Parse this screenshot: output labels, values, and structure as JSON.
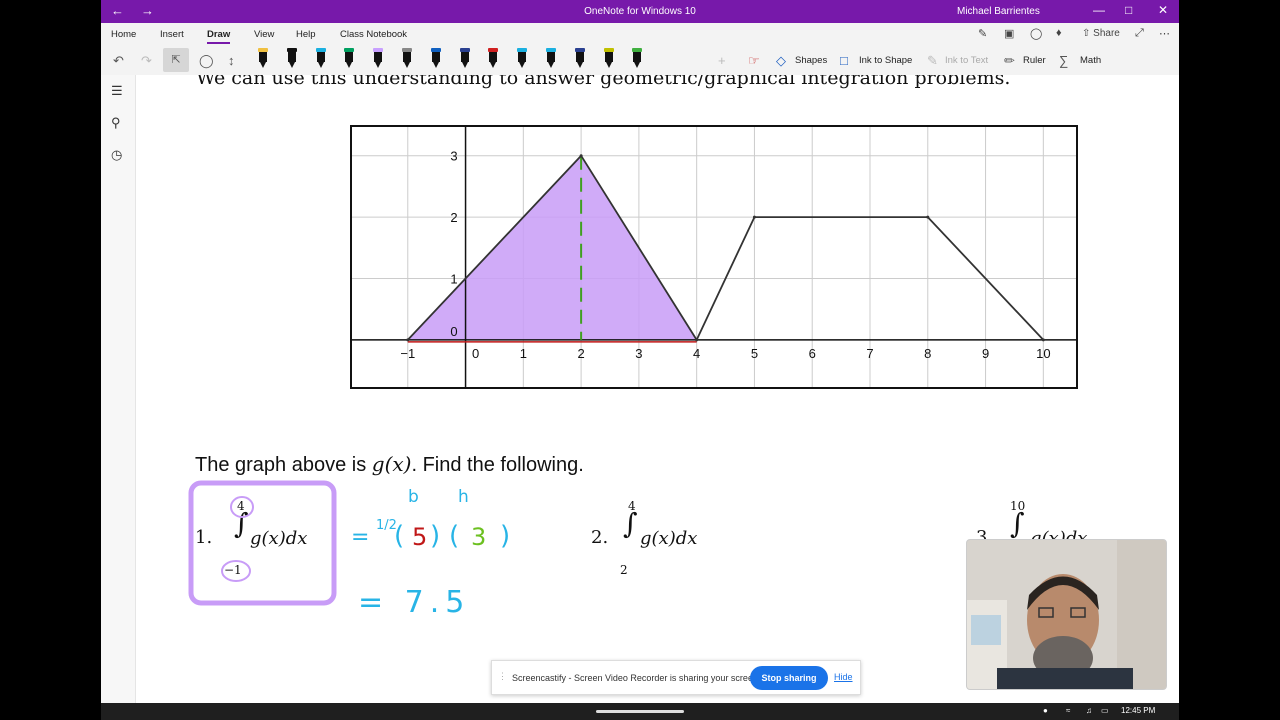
{
  "window": {
    "title": "OneNote for Windows 10",
    "user": "Michael Barrientes"
  },
  "menu": {
    "tabs": [
      "Home",
      "Insert",
      "Draw",
      "View",
      "Help",
      "Class Notebook"
    ],
    "share_label": "Share"
  },
  "toolbar": {
    "shapes": "Shapes",
    "ink_to_shape": "Ink to Shape",
    "ink_to_text": "Ink to Text",
    "ruler": "Ruler",
    "math": "Math",
    "pen_colors": [
      "#f0c040",
      "#111111",
      "#1ab0e0",
      "#00a060",
      "#c8a0ff",
      "#888888",
      "#1060c0",
      "#2a4090",
      "#d02020",
      "#1ab0e0",
      "#1ab0e0",
      "#2a4090",
      "#c0c000",
      "#40b040"
    ]
  },
  "page": {
    "heading": "We can use this understanding to answer geometric/graphical integration problems.",
    "question_prefix": "The graph above is ",
    "question_func": "g(x)",
    "question_suffix": ".  Find the following.",
    "problems": [
      {
        "num": "1.",
        "upper": "4",
        "lower": "−1",
        "integrand": "g(x)dx"
      },
      {
        "num": "2.",
        "upper": "4",
        "lower": "2",
        "integrand": "g(x)dx"
      },
      {
        "num": "3.",
        "upper": "10",
        "lower": "",
        "integrand": "g(x)dx"
      }
    ],
    "ink": {
      "half": "1/2",
      "eq1": "=",
      "b_label": "b",
      "h_label": "h",
      "base": "5",
      "height": "3",
      "open_paren": "(",
      "close_paren": ")",
      "answer": "= 7.5"
    }
  },
  "chart_data": {
    "type": "line",
    "x": [
      -1,
      2,
      4,
      5,
      8,
      10
    ],
    "y": [
      0,
      3,
      0,
      2,
      2,
      0
    ],
    "x_ticks": [
      "−1",
      "0",
      "1",
      "2",
      "3",
      "4",
      "5",
      "6",
      "7",
      "8",
      "9",
      "10"
    ],
    "y_ticks": [
      "0",
      "1",
      "2",
      "3"
    ],
    "xlim": [
      -2,
      10.6
    ],
    "ylim": [
      -0.8,
      3.5
    ],
    "grid": true,
    "shaded_region": {
      "from": -1,
      "to": 4,
      "color": "#c89cf7"
    }
  },
  "share_bar": {
    "message": "Screencastify - Screen Video Recorder is sharing your screen.",
    "stop": "Stop sharing",
    "hide": "Hide"
  },
  "taskbar": {
    "time": "12:45 PM"
  }
}
